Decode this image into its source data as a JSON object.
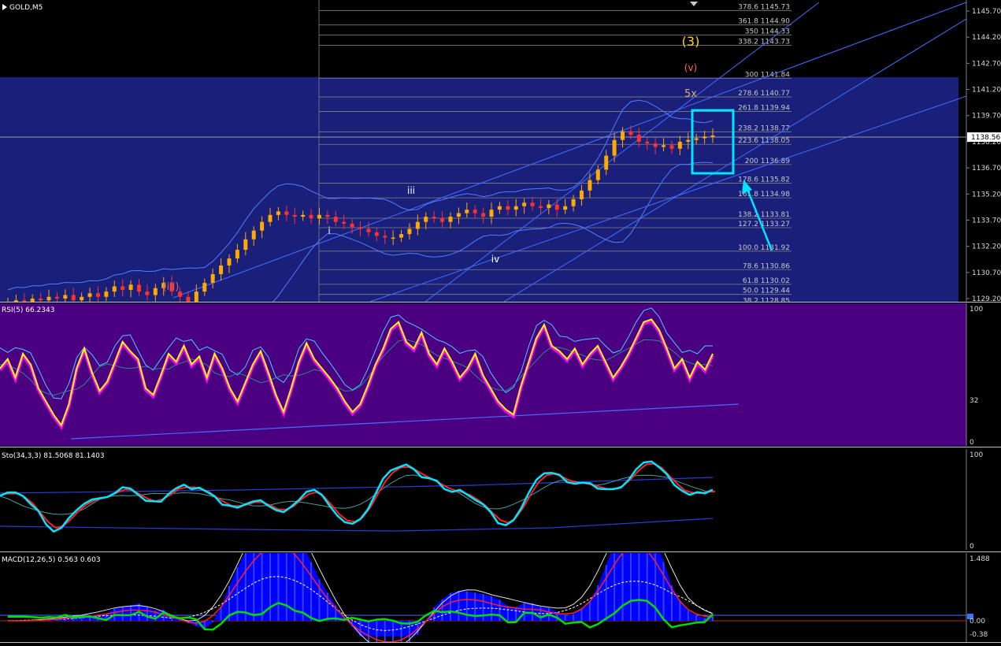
{
  "window": {
    "symbol_timeframe": "GOLD,M5"
  },
  "colors": {
    "background": "#000000",
    "main_overlay": "#1a1f7a",
    "rsi_background": "#4b0082",
    "rsi_line": "#ffff00",
    "rsi_shadow": "#ff00ff",
    "stoch_main": "#00e5ff",
    "stoch_signal": "#ff2020",
    "macd_hist": "#0000ff",
    "macd_signal_line": "#00dd00",
    "fib_line": "#808080",
    "trend_line": "#3f6fff",
    "highlight_box": "#00e5ff"
  },
  "price_axis": {
    "ticks": [
      "1145.70",
      "1144.20",
      "1142.70",
      "1141.20",
      "1139.70",
      "1138.20",
      "1136.70",
      "1135.20",
      "1133.70",
      "1132.20",
      "1130.70",
      "1129.20"
    ],
    "current_price": "1138.56"
  },
  "fib_levels": [
    "378.6 1145.73",
    "361.8 1144.90",
    "350 1144.33",
    "338.2 1143.73",
    "300 1141.84",
    "278.6 1140.77",
    "261.8 1139.94",
    "238.2 1138.77",
    "223.6 1138.05",
    "200 1136.89",
    "178.6 1135.82",
    "161.8 1134.98",
    "138.2 1133.81",
    "127.2 1133.27",
    "100.0 1131.92",
    "78.6 1130.86",
    "61.8 1130.02",
    "50.0 1129.44",
    "38.2 1128.85"
  ],
  "wave_labels": {
    "major": "(3)",
    "minor_v": "(v)",
    "target": "5x",
    "iii_paren": "(iii)",
    "i": "i",
    "iii": "iii",
    "iv": "iv"
  },
  "panels": {
    "rsi": {
      "label": "RSI(5) 66.2343",
      "ticks": [
        "100",
        "32",
        "0"
      ]
    },
    "stoch": {
      "label": "Sto(34,3,3) 81.5068 81.1403",
      "ticks": [
        "100",
        "0"
      ]
    },
    "macd": {
      "label": "MACD(12,26,5) 0.563 0.603",
      "ticks": [
        "1.488",
        "0.00",
        "-0.38"
      ]
    }
  },
  "chart_data": {
    "type": "line",
    "title": "GOLD,M5",
    "ylim": [
      1128.7,
      1146.2
    ],
    "price": [
      1129.0,
      1129.1,
      1129.0,
      1129.2,
      1129.1,
      1129.3,
      1129.2,
      1129.4,
      1129.1,
      1129.3,
      1129.5,
      1129.3,
      1129.6,
      1129.9,
      1129.7,
      1130.0,
      1129.6,
      1129.4,
      1129.8,
      1130.1,
      1129.6,
      1129.3,
      1129.0,
      1129.6,
      1130.1,
      1130.6,
      1131.1,
      1131.5,
      1132.0,
      1132.6,
      1133.1,
      1133.6,
      1134.0,
      1134.2,
      1134.0,
      1133.9,
      1134.0,
      1133.8,
      1134.0,
      1133.9,
      1133.6,
      1133.5,
      1133.3,
      1133.2,
      1133.0,
      1132.8,
      1132.7,
      1132.7,
      1132.9,
      1133.2,
      1133.6,
      1133.9,
      1133.8,
      1133.6,
      1133.9,
      1134.1,
      1134.3,
      1134.1,
      1133.9,
      1134.3,
      1134.5,
      1134.3,
      1134.5,
      1134.7,
      1134.5,
      1134.4,
      1134.6,
      1134.3,
      1134.5,
      1134.9,
      1135.4,
      1136.0,
      1136.6,
      1137.4,
      1138.3,
      1138.8,
      1138.6,
      1138.2,
      1138.1,
      1137.9,
      1138.0,
      1137.8,
      1138.2,
      1138.3,
      1138.4,
      1138.5,
      1138.56
    ],
    "rsi": [
      55,
      62,
      48,
      66,
      58,
      40,
      30,
      20,
      12,
      28,
      55,
      70,
      52,
      38,
      45,
      60,
      75,
      68,
      62,
      40,
      35,
      50,
      66,
      60,
      72,
      58,
      64,
      48,
      66,
      55,
      40,
      30,
      44,
      58,
      68,
      52,
      35,
      22,
      40,
      60,
      74,
      62,
      55,
      48,
      40,
      30,
      22,
      28,
      42,
      58,
      70,
      85,
      90,
      75,
      70,
      82,
      66,
      58,
      70,
      60,
      48,
      55,
      66,
      50,
      40,
      30,
      24,
      20,
      42,
      60,
      78,
      88,
      72,
      68,
      62,
      70,
      58,
      66,
      72,
      60,
      48,
      56,
      66,
      78,
      90,
      92,
      84,
      70,
      55,
      62,
      48,
      60,
      54,
      66
    ]
  }
}
